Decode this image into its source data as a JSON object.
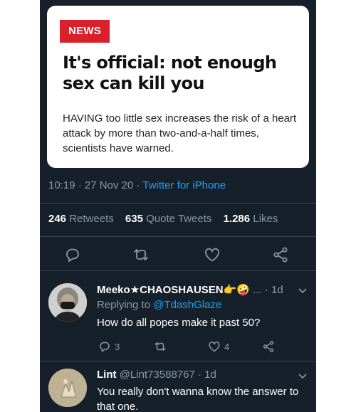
{
  "article": {
    "badge": "NEWS",
    "headline": "It's official: not enough sex can kill you",
    "lede": "HAVING too little sex increases the risk of a heart attack by more than two-and-a-half times, scientists have warned."
  },
  "tweet": {
    "time": "10:19 · 27 Nov 20 · ",
    "source": "Twitter for iPhone",
    "retweets_count": "246",
    "retweets_label": "Retweets",
    "quotes_count": "635",
    "quotes_label": "Quote Tweets",
    "likes_count": "1.286",
    "likes_label": "Likes"
  },
  "replies": [
    {
      "name": "Meeko★CHAOSHAUSEN",
      "emoji": "👉🤪",
      "meta": "... · 1d",
      "replying_prefix": "Replying to ",
      "replying_handle": "@TdashGlaze",
      "text": "How do all popes make it past 50?",
      "reply_count": "3",
      "like_count": "4"
    },
    {
      "name": "Lint",
      "handle": "@Lint73588767 · 1d",
      "text": "You really don't wanna know the answer to that one."
    }
  ],
  "colors": {
    "background": "#15202b",
    "muted": "#8899a6",
    "link": "#1da1f2",
    "badge": "#d9202b"
  },
  "icons": [
    "reply-icon",
    "retweet-icon",
    "like-icon",
    "share-icon",
    "chevron-down-icon"
  ]
}
